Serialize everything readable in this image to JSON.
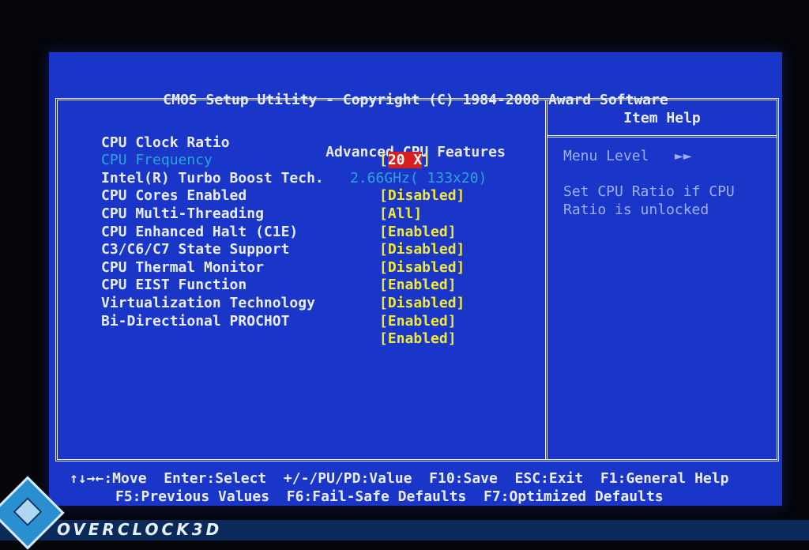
{
  "header": {
    "title_line1": "CMOS Setup Utility - Copyright (C) 1984-2008 Award Software",
    "title_line2": "Advanced CPU Features"
  },
  "settings": [
    {
      "label": "CPU Clock Ratio",
      "value": "20 X",
      "selected": true
    },
    {
      "label": "CPU Frequency",
      "value": "2.66GHz( 133x20)",
      "readonly": true
    },
    {
      "label": "Intel(R) Turbo Boost Tech.",
      "value": "[Disabled]"
    },
    {
      "label": "CPU Cores Enabled",
      "value": "[All]"
    },
    {
      "label": "CPU Multi-Threading",
      "value": "[Enabled]"
    },
    {
      "label": "CPU Enhanced Halt (C1E)",
      "value": "[Disabled]"
    },
    {
      "label": "C3/C6/C7 State Support",
      "value": "[Disabled]"
    },
    {
      "label": "CPU Thermal Monitor",
      "value": "[Enabled]"
    },
    {
      "label": "CPU EIST Function",
      "value": "[Disabled]"
    },
    {
      "label": "Virtualization Technology",
      "value": "[Enabled]"
    },
    {
      "label": "Bi-Directional PROCHOT",
      "value": "[Enabled]"
    }
  ],
  "help": {
    "title": "Item Help",
    "menu_level_label": "Menu Level",
    "menu_level_icon": "double-right-arrow-icon",
    "menu_level_glyph": "►►",
    "text": "Set CPU Ratio if CPU Ratio is unlocked"
  },
  "footer": {
    "line1": "↑↓→←:Move  Enter:Select  +/-/PU/PD:Value  F10:Save  ESC:Exit  F1:General Help",
    "line2": "F5:Previous Values  F6:Fail-Safe Defaults  F7:Optimized Defaults"
  },
  "watermark": {
    "brand": "OVERCLOCK3D"
  },
  "colors": {
    "background": "#1a36c9",
    "text": "#e8ecff",
    "value": "#f0e83a",
    "highlight": "#d81e1e",
    "readonly": "#29a6d8"
  }
}
